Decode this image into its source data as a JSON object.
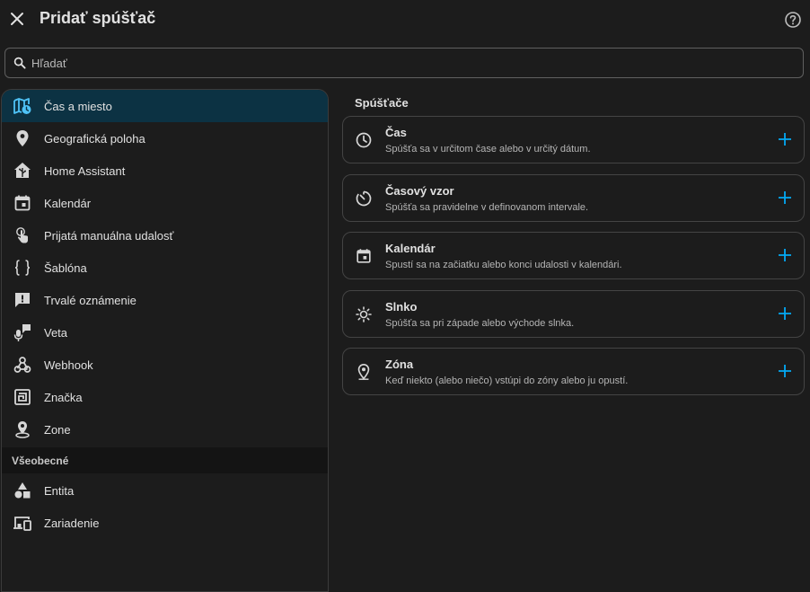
{
  "header": {
    "title": "Pridať spúšťač"
  },
  "search": {
    "placeholder": "Hľadať"
  },
  "sidebar": {
    "items": [
      {
        "label": "Čas a miesto",
        "icon": "map-clock-icon",
        "active": true
      },
      {
        "label": "Geografická poloha",
        "icon": "map-marker-icon"
      },
      {
        "label": "Home Assistant",
        "icon": "home-assistant-icon"
      },
      {
        "label": "Kalendár",
        "icon": "calendar-icon"
      },
      {
        "label": "Prijatá manuálna udalosť",
        "icon": "gesture-tap-icon"
      },
      {
        "label": "Šablóna",
        "icon": "code-braces-icon"
      },
      {
        "label": "Trvalé oznámenie",
        "icon": "message-alert-icon"
      },
      {
        "label": "Veta",
        "icon": "microphone-message-icon"
      },
      {
        "label": "Webhook",
        "icon": "webhook-icon"
      },
      {
        "label": "Značka",
        "icon": "nfc-tag-icon"
      },
      {
        "label": "Zone",
        "icon": "map-marker-radius-icon"
      }
    ],
    "section_label": "Všeobecné",
    "general_items": [
      {
        "label": "Entita",
        "icon": "shape-icon"
      },
      {
        "label": "Zariadenie",
        "icon": "devices-icon"
      }
    ]
  },
  "main": {
    "title": "Spúšťače",
    "cards": [
      {
        "title": "Čas",
        "desc": "Spúšťa sa v určitom čase alebo v určitý dátum.",
        "icon": "clock-icon"
      },
      {
        "title": "Časový vzor",
        "desc": "Spúšťa sa pravidelne v definovanom intervale.",
        "icon": "timer-outline-icon"
      },
      {
        "title": "Kalendár",
        "desc": "Spustí sa na začiatku alebo konci udalosti v kalendári.",
        "icon": "calendar-icon"
      },
      {
        "title": "Slnko",
        "desc": "Spúšťa sa pri západe alebo východe slnka.",
        "icon": "sun-icon"
      },
      {
        "title": "Zóna",
        "desc": "Keď niekto (alebo niečo) vstúpi do zóny alebo ju opustí.",
        "icon": "map-marker-icon"
      }
    ]
  },
  "colors": {
    "background": "#1c1c1c",
    "active_bg": "#0c3243",
    "accent": "#03a9f4",
    "active_icon": "#4fc3f7"
  }
}
